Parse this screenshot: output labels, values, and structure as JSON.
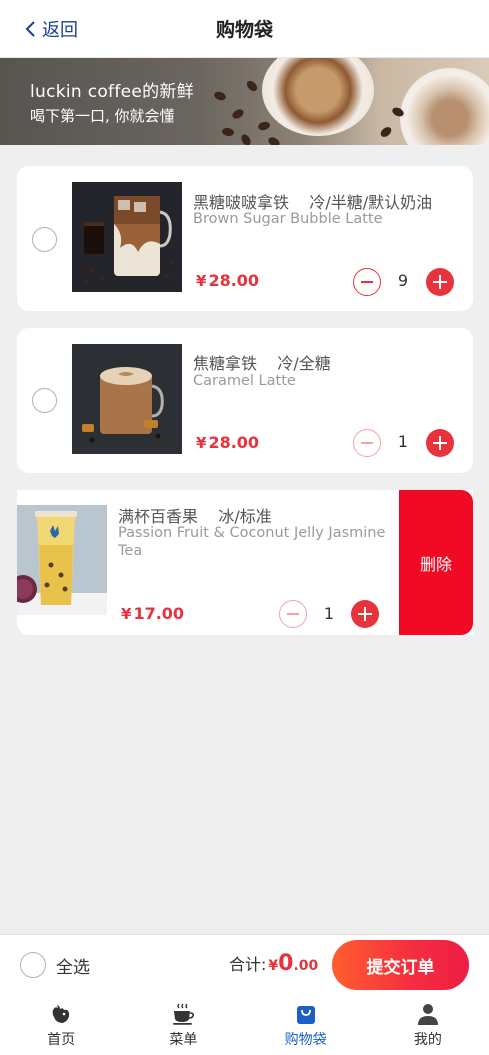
{
  "header": {
    "back_label": "返回",
    "title": "购物袋"
  },
  "banner": {
    "line1": "luckin coffee的新鲜",
    "line2": "喝下第一口, 你就会懂"
  },
  "items": [
    {
      "name": "黑糖啵啵拿铁",
      "options": "冷/半糖/默认奶油",
      "english": "Brown Sugar Bubble Latte",
      "currency": "¥",
      "price": "28.00",
      "quantity": "9",
      "selected": false
    },
    {
      "name": "焦糖拿铁",
      "options": "冷/全糖",
      "english": "Caramel Latte",
      "currency": "¥",
      "price": "28.00",
      "quantity": "1",
      "selected": false
    },
    {
      "name": "满杯百香果",
      "options": "冰/标准",
      "english": "Passion Fruit & Coconut Jelly Jasmine Tea",
      "currency": "¥",
      "price": "17.00",
      "quantity": "1",
      "selected": false,
      "delete_label": "删除"
    }
  ],
  "footer": {
    "select_all_label": "全选",
    "total_label": "合计:",
    "total_currency": "¥",
    "total_int": "0",
    "total_dec": ".00",
    "submit_label": "提交订单"
  },
  "tabs": [
    {
      "label": "首页",
      "icon": "deer-logo-icon",
      "active": false
    },
    {
      "label": "菜单",
      "icon": "coffee-cup-icon",
      "active": false
    },
    {
      "label": "购物袋",
      "icon": "shopping-bag-icon",
      "active": true
    },
    {
      "label": "我的",
      "icon": "user-icon",
      "active": false
    }
  ],
  "colors": {
    "accent_red": "#e8323c",
    "delete_red": "#f10a24",
    "brand_blue": "#1c3f94",
    "active_tab": "#1b5fc9"
  }
}
